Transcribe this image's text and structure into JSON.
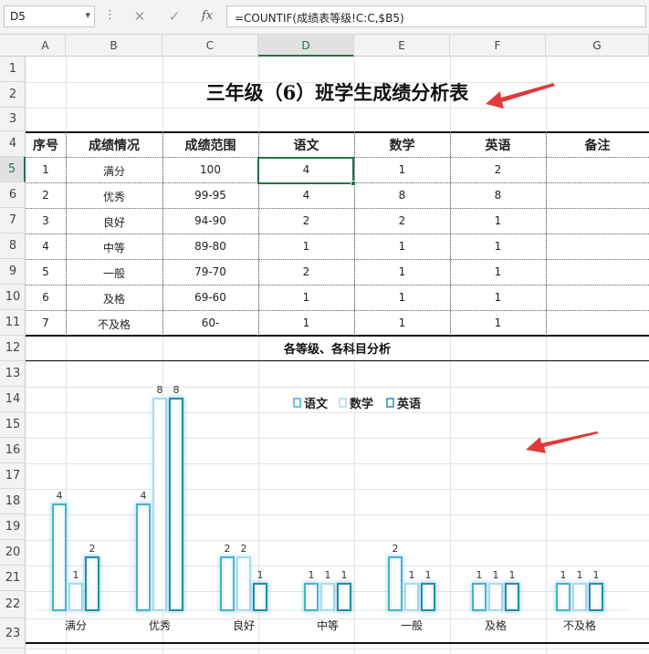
{
  "formula_bar": {
    "name_box": "D5",
    "cancel_glyph": "✕",
    "enter_glyph": "✓",
    "fx_glyph": "fx",
    "formula": "=COUNTIF(成绩表等级!C:C,$B5)"
  },
  "columns": [
    "A",
    "B",
    "C",
    "D",
    "E",
    "F",
    "G"
  ],
  "rows": [
    "1",
    "2",
    "3",
    "4",
    "5",
    "6",
    "7",
    "8",
    "9",
    "10",
    "11",
    "12",
    "13",
    "14",
    "15",
    "16",
    "17",
    "18",
    "19",
    "20",
    "21",
    "22",
    "23"
  ],
  "sheet": {
    "title": "三年级（6）班学生成绩分析表",
    "headers": [
      "序号",
      "成绩情况",
      "成绩范围",
      "语文",
      "数学",
      "英语",
      "备注"
    ],
    "table_rows": [
      [
        "1",
        "满分",
        "100",
        "4",
        "1",
        "2",
        ""
      ],
      [
        "2",
        "优秀",
        "99-95",
        "4",
        "8",
        "8",
        ""
      ],
      [
        "3",
        "良好",
        "94-90",
        "2",
        "2",
        "1",
        ""
      ],
      [
        "4",
        "中等",
        "89-80",
        "1",
        "1",
        "1",
        ""
      ],
      [
        "5",
        "一般",
        "79-70",
        "2",
        "1",
        "1",
        ""
      ],
      [
        "6",
        "及格",
        "69-60",
        "1",
        "1",
        "1",
        ""
      ],
      [
        "7",
        "不及格",
        "60-",
        "1",
        "1",
        "1",
        ""
      ]
    ],
    "section_title": "各等级、各科目分析"
  },
  "chart_data": {
    "type": "bar",
    "categories": [
      "满分",
      "优秀",
      "良好",
      "中等",
      "一般",
      "及格",
      "不及格"
    ],
    "series": [
      {
        "name": "语文",
        "values": [
          4,
          4,
          2,
          1,
          2,
          1,
          1
        ]
      },
      {
        "name": "数学",
        "values": [
          1,
          8,
          2,
          1,
          1,
          1,
          1
        ]
      },
      {
        "name": "英语",
        "values": [
          2,
          8,
          1,
          1,
          1,
          1,
          1
        ]
      }
    ],
    "legend_position": "top-right",
    "ylim": [
      0,
      8
    ],
    "data_labels": true,
    "colors": {
      "语文": "#3fb4d0",
      "数学": "#a9dcef",
      "英语": "#1d8fb0"
    }
  },
  "colors": {
    "accent_green": "#217346",
    "arrow_red": "#e03a3a"
  }
}
